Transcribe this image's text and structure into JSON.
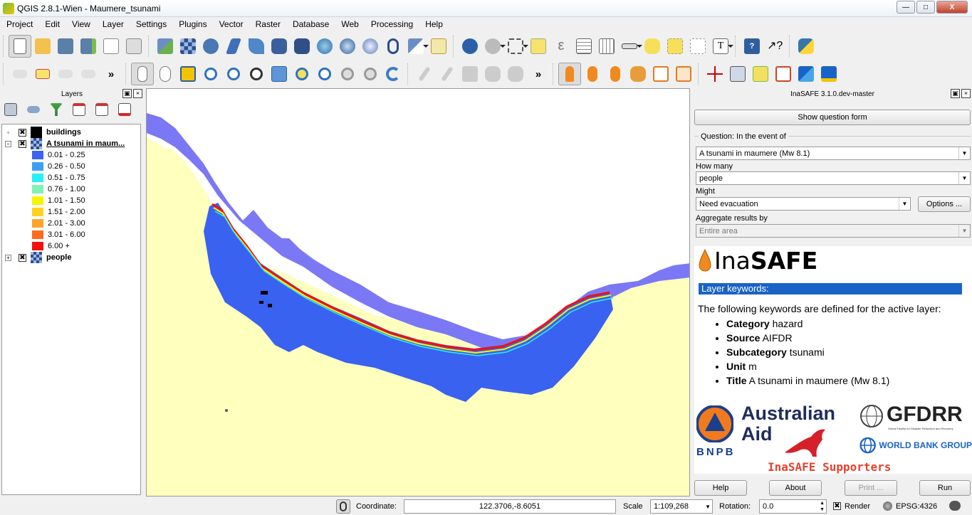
{
  "window": {
    "title": "QGIS 2.8.1-Wien - Maumere_tsunami",
    "minimize": "—",
    "maximize": "□",
    "close": "X"
  },
  "menu": [
    "Project",
    "Edit",
    "View",
    "Layer",
    "Settings",
    "Plugins",
    "Vector",
    "Raster",
    "Database",
    "Web",
    "Processing",
    "Help"
  ],
  "toolbar_overflow": "»",
  "layers_panel": {
    "title": "Layers",
    "float_btn": "▣",
    "close_btn": "×",
    "layers": [
      {
        "name": "buildings",
        "checked": "✖",
        "expand": "+"
      },
      {
        "name": "A tsunami in maum...",
        "checked": "✖",
        "expand": "−"
      },
      {
        "name": "people",
        "checked": "✖",
        "expand": "+"
      }
    ],
    "legend": [
      {
        "label": "0.01 - 0.25",
        "color": "#3d63f0"
      },
      {
        "label": "0.26 - 0.50",
        "color": "#3ea0f5"
      },
      {
        "label": "0.51 - 0.75",
        "color": "#27f0f7"
      },
      {
        "label": "0.76 - 1.00",
        "color": "#7ff3b5"
      },
      {
        "label": "1.01 - 1.50",
        "color": "#f5f500"
      },
      {
        "label": "1.51 - 2.00",
        "color": "#ffd21e"
      },
      {
        "label": "2.01 - 3.00",
        "color": "#ffa52a"
      },
      {
        "label": "3.01 - 6.00",
        "color": "#ff6a1f"
      },
      {
        "label": "6.00 +",
        "color": "#f50f0f"
      }
    ]
  },
  "inasafe": {
    "title": "InaSAFE 3.1.0.dev-master",
    "float_btn": "▣",
    "close_btn": "×",
    "show_question_form": "Show question form",
    "question_label": "Question: In the event of",
    "hazard_value": "A tsunami in maumere (Mw 8.1)",
    "how_many_label": "How many",
    "exposure_value": "people",
    "might_label": "Might",
    "function_value": "Need evacuation",
    "options_button": "Options ...",
    "aggregate_label": "Aggregate results by",
    "aggregate_value": "Entire area",
    "logo_ina": "Ina",
    "logo_safe": "SAFE",
    "keywords_header": "Layer keywords:",
    "keywords_intro": "The following keywords are defined for the active layer:",
    "keywords": [
      {
        "key": "Category",
        "value": "hazard"
      },
      {
        "key": "Source",
        "value": "AIFDR"
      },
      {
        "key": "Subcategory",
        "value": "tsunami"
      },
      {
        "key": "Unit",
        "value": "m"
      },
      {
        "key": "Title",
        "value": "A tsunami in maumere (Mw 8.1)"
      }
    ],
    "supporters": {
      "bnpb": "BNPB",
      "australian": "Australian",
      "aid": "Aid",
      "gfdrr": "GFDRR",
      "gfdrr_sub": "Global Facility for Disaster Reduction and Recovery",
      "world_bank": "WORLD BANK GROUP",
      "caption": "InaSAFE Supporters"
    },
    "buttons": {
      "help": "Help",
      "about": "About",
      "print": "Print ...",
      "run": "Run"
    }
  },
  "statusbar": {
    "coordinate_label": "Coordinate:",
    "coordinate_value": "122.3706,-8.6051",
    "scale_label": "Scale",
    "scale_value": "1:109,268",
    "rotation_label": "Rotation:",
    "rotation_value": "0.0",
    "render_label": "Render",
    "render_checked": "✖",
    "epsg": "EPSG:4326"
  },
  "colors": {
    "land": "#ffffbe",
    "sea_shallow": "#7b78f5",
    "sea_deep": "#3a62f0",
    "inasafe_blue": "#1a63c6",
    "supporters_red": "#e8402b"
  }
}
